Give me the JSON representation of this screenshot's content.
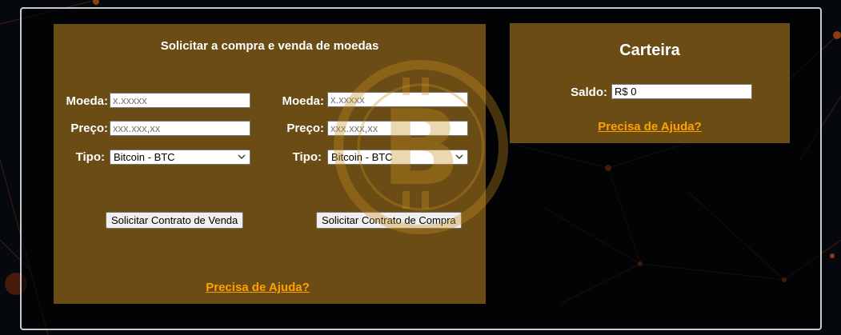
{
  "left_panel": {
    "title": "Solicitar a compra e venda de moedas",
    "sell_form": {
      "moeda_label": "Moeda:",
      "moeda_placeholder": "x.xxxxx",
      "preco_label": "Preço:",
      "preco_placeholder": "xxx.xxx,xx",
      "tipo_label": "Tipo:",
      "tipo_selected": "Bitcoin - BTC",
      "submit_label": "Solicitar Contrato de Venda"
    },
    "buy_form": {
      "moeda_label": "Moeda:",
      "moeda_placeholder": "x.xxxxx",
      "preco_label": "Preço:",
      "preco_placeholder": "xxx.xxx,xx",
      "tipo_label": "Tipo:",
      "tipo_selected": "Bitcoin - BTC",
      "submit_label": "Solicitar Contrato de Compra"
    },
    "help_link": "Precisa de Ajuda?"
  },
  "wallet": {
    "title": "Carteira",
    "saldo_label": "Saldo:",
    "saldo_value": "R$ 0",
    "help_link": "Precisa de Ajuda?"
  },
  "colors": {
    "panel": "#7d5819",
    "link": "#ffa200",
    "background": "#05080d"
  }
}
